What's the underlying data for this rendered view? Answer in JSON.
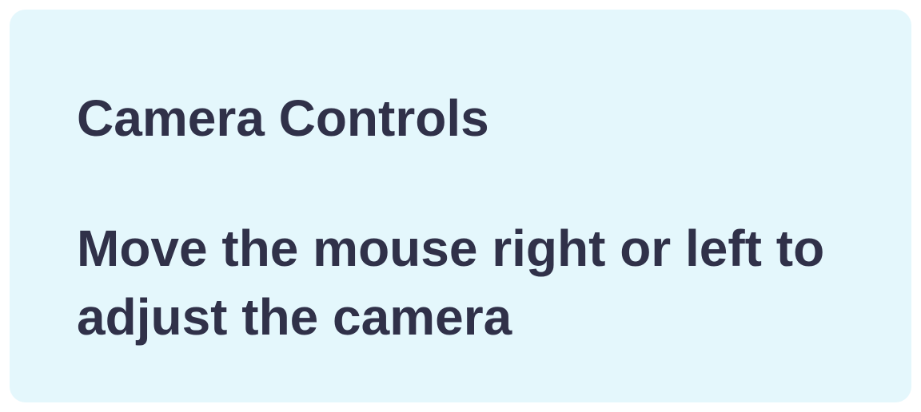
{
  "panel": {
    "title": "Camera Controls",
    "instruction": "Move the mouse right or left to adjust the camera"
  },
  "colors": {
    "background": "#e4f7fc",
    "text": "#303149"
  }
}
